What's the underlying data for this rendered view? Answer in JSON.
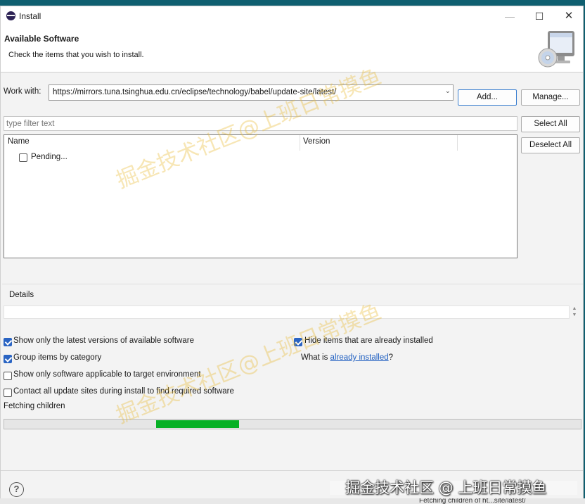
{
  "window": {
    "title": "Install",
    "controls": {
      "minimize": "—",
      "maximize": "☐",
      "close": "✕"
    }
  },
  "header": {
    "title": "Available Software",
    "subtitle": "Check the items that you wish to install."
  },
  "work_with": {
    "label": "Work with:",
    "url": "https://mirrors.tuna.tsinghua.edu.cn/eclipse/technology/babel/update-site/latest/",
    "add_button": "Add...",
    "manage_button": "Manage..."
  },
  "filter": {
    "placeholder": "type filter text"
  },
  "buttons": {
    "select_all": "Select All",
    "deselect_all": "Deselect All"
  },
  "table": {
    "columns": [
      "Name",
      "Version"
    ],
    "rows": [
      {
        "name": "Pending...",
        "checked": false
      }
    ]
  },
  "details": {
    "label": "Details"
  },
  "options": {
    "latest_versions": {
      "label": "Show only the latest versions of available software",
      "checked": true
    },
    "group_by_category": {
      "label": "Group items by category",
      "checked": true
    },
    "applicable_only": {
      "label": "Show only software applicable to target environment",
      "checked": false
    },
    "contact_sites": {
      "label": "Contact all update sites during install to find required software",
      "checked": false
    },
    "hide_installed": {
      "label": "Hide items that are already installed",
      "checked": true
    },
    "what_is": {
      "prefix": "What is ",
      "link": "already installed",
      "suffix": "?"
    }
  },
  "status": {
    "text": "Fetching children",
    "progress_start": 0.263,
    "progress_end": 0.407
  },
  "watermark": {
    "text": "掘金技术社区@上班日常摸鱼"
  },
  "credit": {
    "text": "掘金技术社区 @ 上班日常摸鱼"
  },
  "taskbar": {
    "text": "Fetching children of ht...site/latest/"
  },
  "colors": {
    "progress": "#06b025",
    "link": "#1f5fc1",
    "checkbox": "#2a64c3"
  }
}
